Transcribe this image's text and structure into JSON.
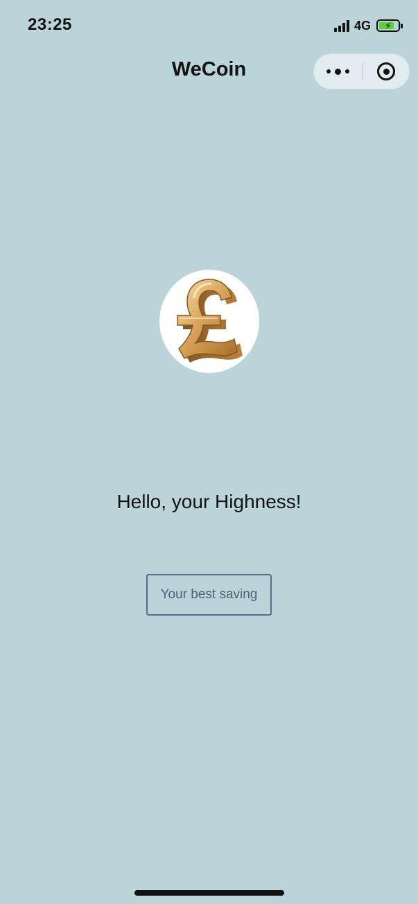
{
  "status_bar": {
    "time": "23:25",
    "network": "4G",
    "battery_level": 0.8,
    "charging": true,
    "battery_color": "#5fcd3c",
    "bolt_glyph": "⚡"
  },
  "nav": {
    "title": "WeCoin",
    "more_icon": "more-dots-icon",
    "close_icon": "target-close-icon"
  },
  "main": {
    "logo_icon": "gold-pound-sign",
    "greeting": "Hello, your Highness!",
    "button_label": "Your best saving"
  },
  "colors": {
    "background": "#bbd4da",
    "button_border": "#5d6f86",
    "button_text": "#4f6178",
    "capsule": "#e6eff1"
  }
}
